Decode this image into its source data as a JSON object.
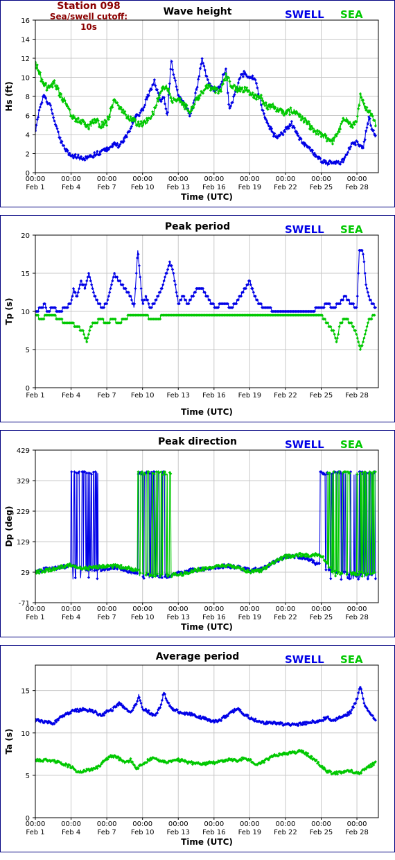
{
  "header": {
    "station": "Station 098",
    "cutoff": "Sea/swell cutoff: 10s"
  },
  "legend": {
    "swell": "SWELL",
    "sea": "SEA"
  },
  "colors": {
    "swell": "#0000e6",
    "sea": "#00c800",
    "station": "#8b0000",
    "border": "#000080"
  },
  "chart_data": [
    {
      "type": "line",
      "title": "Wave height",
      "xlabel": "Time (UTC)",
      "ylabel": "Hs (ft)",
      "ylim": [
        0,
        16
      ],
      "yticks": [
        0,
        2,
        4,
        6,
        8,
        10,
        12,
        14,
        16
      ],
      "xlim": [
        0,
        28.8
      ],
      "xticks": [
        0,
        3,
        6,
        9,
        12,
        15,
        18,
        21,
        24,
        27
      ],
      "xtick_top": "00:00",
      "xtick_labels": [
        "Feb 1",
        "Feb 4",
        "Feb 7",
        "Feb 10",
        "Feb 13",
        "Feb 16",
        "Feb 19",
        "Feb 22",
        "Feb 25",
        "Feb 28"
      ],
      "show_time_row": true,
      "grid": true,
      "series": [
        {
          "name": "SWELL",
          "color": "#0000e6",
          "noise": 0.25,
          "x": [
            0,
            0.3,
            0.7,
            1.2,
            1.6,
            2.0,
            2.5,
            3.0,
            4.0,
            5.0,
            6.0,
            6.6,
            7.0,
            7.6,
            8.0,
            8.4,
            9.0,
            9.6,
            10.0,
            10.5,
            10.8,
            11.1,
            11.4,
            12.0,
            12.6,
            13.0,
            13.3,
            13.6,
            14.0,
            14.5,
            15.0,
            15.5,
            16.0,
            16.3,
            16.8,
            17.2,
            17.6,
            18.0,
            18.4,
            18.8,
            19.2,
            19.6,
            20.0,
            20.5,
            21.0,
            21.5,
            22.0,
            22.5,
            23.0,
            23.5,
            24.0,
            24.5,
            25.0,
            25.5,
            26.0,
            26.5,
            27.0,
            27.5,
            28.0,
            28.3,
            28.6
          ],
          "y": [
            4.2,
            6.5,
            8.0,
            7.2,
            5.5,
            3.8,
            2.5,
            1.8,
            1.5,
            1.9,
            2.5,
            3.0,
            2.8,
            3.8,
            4.5,
            5.8,
            6.5,
            8.5,
            9.5,
            7.5,
            8.0,
            6.0,
            11.8,
            8.0,
            7.2,
            5.8,
            7.5,
            9.0,
            12.0,
            9.5,
            8.5,
            9.0,
            11.0,
            6.5,
            8.5,
            10.0,
            10.5,
            9.8,
            10.0,
            8.0,
            6.0,
            5.0,
            4.0,
            3.8,
            4.5,
            5.2,
            4.0,
            3.0,
            2.5,
            1.8,
            1.2,
            1.0,
            1.1,
            1.0,
            1.5,
            3.0,
            3.2,
            2.5,
            5.8,
            4.5,
            3.6
          ]
        },
        {
          "name": "SEA",
          "color": "#00c800",
          "noise": 0.35,
          "x": [
            0,
            0.3,
            0.7,
            1.2,
            1.6,
            2.0,
            2.5,
            3.0,
            4.0,
            4.5,
            5.0,
            5.5,
            6.0,
            6.6,
            7.0,
            7.5,
            8.0,
            8.5,
            9.0,
            9.5,
            10.0,
            10.5,
            11.0,
            11.5,
            12.0,
            12.5,
            13.0,
            13.5,
            14.0,
            14.5,
            15.0,
            15.5,
            16.0,
            16.5,
            17.0,
            17.5,
            18.0,
            18.5,
            19.0,
            19.5,
            20.0,
            20.5,
            21.0,
            21.5,
            22.0,
            22.5,
            23.0,
            23.5,
            24.0,
            24.5,
            25.0,
            25.5,
            26.0,
            26.5,
            27.0,
            27.3,
            27.6,
            28.0,
            28.3,
            28.6
          ],
          "y": [
            11.5,
            10.5,
            9.2,
            8.8,
            9.5,
            8.3,
            7.5,
            6.0,
            5.2,
            4.8,
            5.5,
            5.0,
            5.3,
            7.5,
            7.0,
            6.2,
            5.6,
            5.2,
            5.0,
            5.6,
            6.5,
            8.5,
            9.2,
            7.5,
            7.8,
            7.0,
            6.5,
            7.5,
            8.5,
            9.0,
            8.7,
            8.5,
            10.2,
            9.0,
            8.8,
            8.8,
            8.5,
            8.0,
            7.8,
            6.8,
            7.0,
            6.5,
            6.2,
            6.5,
            6.3,
            5.5,
            5.0,
            4.2,
            4.0,
            3.6,
            3.3,
            4.5,
            5.8,
            5.0,
            5.2,
            8.5,
            7.0,
            6.5,
            6.0,
            5.0
          ]
        }
      ]
    },
    {
      "type": "line",
      "title": "Peak period",
      "xlabel": "Time (UTC)",
      "ylabel": "Tp (s)",
      "ylim": [
        0,
        20
      ],
      "yticks": [
        0,
        5,
        10,
        15,
        20
      ],
      "xlim": [
        0,
        28.8
      ],
      "xticks": [
        0,
        3,
        6,
        9,
        12,
        15,
        18,
        21,
        24,
        27
      ],
      "xtick_labels": [
        "Feb 1",
        "Feb 4",
        "Feb 7",
        "Feb 10",
        "Feb 13",
        "Feb 16",
        "Feb 19",
        "Feb 22",
        "Feb 25",
        "Feb 28"
      ],
      "show_time_row": false,
      "grid": true,
      "series": [
        {
          "name": "SWELL",
          "color": "#0000e6",
          "noise": 0.0,
          "spiky": true,
          "x": [
            0,
            0.5,
            0.8,
            1.0,
            1.5,
            2.0,
            2.5,
            3.0,
            3.2,
            3.5,
            3.8,
            4.2,
            4.5,
            5.0,
            5.3,
            5.6,
            6.0,
            6.3,
            6.6,
            7.0,
            7.5,
            8.0,
            8.3,
            8.6,
            9.0,
            9.3,
            9.6,
            10.0,
            10.3,
            10.6,
            11.0,
            11.3,
            11.6,
            12.0,
            12.4,
            12.8,
            13.2,
            13.6,
            14.0,
            14.4,
            14.8,
            15.2,
            15.6,
            16.0,
            16.4,
            16.8,
            17.2,
            17.6,
            18.0,
            18.4,
            18.8,
            19.2,
            19.6,
            20.0,
            21.0,
            22.0,
            23.0,
            24.0,
            24.5,
            25.0,
            25.5,
            26.0,
            26.5,
            27.0,
            27.2,
            27.5,
            27.8,
            28.0,
            28.3,
            28.6
          ],
          "y": [
            10,
            10.5,
            11,
            10,
            10.5,
            10,
            10.5,
            11,
            13,
            12,
            14,
            13,
            15,
            12,
            11,
            10.5,
            11,
            13,
            15,
            14,
            13,
            12,
            10.5,
            18,
            11,
            12,
            10.5,
            11,
            12,
            13,
            15,
            16.5,
            15,
            11,
            12,
            11,
            12,
            13,
            13,
            12,
            11,
            10.5,
            11,
            11,
            10.5,
            11,
            12,
            13,
            14,
            12,
            11,
            10.5,
            10.5,
            10,
            10,
            10,
            10,
            10.5,
            11,
            10.5,
            11,
            12,
            11,
            10.5,
            18,
            18,
            13,
            12,
            11,
            10.5
          ]
        },
        {
          "name": "SEA",
          "color": "#00c800",
          "noise": 0.0,
          "spiky": true,
          "x": [
            0,
            0.5,
            1.0,
            1.5,
            2.0,
            2.5,
            3.0,
            3.5,
            4.0,
            4.3,
            4.6,
            5.0,
            5.5,
            6.0,
            6.5,
            7.0,
            7.5,
            8.0,
            9.0,
            10.0,
            11.0,
            12.0,
            13.0,
            14.0,
            15.0,
            16.0,
            17.0,
            18.0,
            19.0,
            20.0,
            21.0,
            22.0,
            23.0,
            23.5,
            24.0,
            24.5,
            25.0,
            25.3,
            25.6,
            26.0,
            26.5,
            27.0,
            27.3,
            27.6,
            28.0,
            28.5
          ],
          "y": [
            9.5,
            9,
            9.5,
            9.5,
            9,
            8.5,
            8.5,
            8,
            7.5,
            6,
            8,
            8.5,
            9,
            8.5,
            9,
            8.5,
            9,
            9.5,
            9.5,
            9,
            9.5,
            9.5,
            9.5,
            9.5,
            9.5,
            9.5,
            9.5,
            9.5,
            9.5,
            9.5,
            9.5,
            9.5,
            9.5,
            9.5,
            9.5,
            8.5,
            7.5,
            6,
            8.5,
            9,
            8.5,
            7,
            5,
            6.5,
            9,
            9.5
          ]
        }
      ]
    },
    {
      "type": "line",
      "title": "Peak direction",
      "xlabel": "Time (UTC)",
      "ylabel": "Dp (deg)",
      "ylim": [
        -71,
        429
      ],
      "yticks": [
        -71,
        29,
        129,
        229,
        329,
        429
      ],
      "xlim": [
        0,
        28.8
      ],
      "xticks": [
        0,
        3,
        6,
        9,
        12,
        15,
        18,
        21,
        24,
        27
      ],
      "xtick_top": "00:00",
      "xtick_labels": [
        "Feb 1",
        "Feb 4",
        "Feb 7",
        "Feb 10",
        "Feb 13",
        "Feb 16",
        "Feb 19",
        "Feb 22",
        "Feb 25",
        "Feb 28"
      ],
      "show_time_row": true,
      "grid": true,
      "series": [
        {
          "name": "SWELL",
          "color": "#0000e6",
          "noise": 6,
          "flip_zones": [
            [
              3.0,
              5.3
            ],
            [
              8.5,
              11.5
            ],
            [
              23.9,
              28.6
            ]
          ],
          "flip_high": 358,
          "flip_low": 5,
          "x": [
            0,
            1,
            2,
            3,
            4,
            5,
            6,
            7,
            8,
            9,
            10,
            11,
            12,
            13,
            14,
            15,
            16,
            17,
            18,
            19,
            20,
            21,
            22,
            23,
            24,
            25,
            26,
            27,
            28,
            28.6
          ],
          "y": [
            29,
            40,
            45,
            50,
            40,
            35,
            40,
            45,
            30,
            20,
            18,
            15,
            25,
            35,
            40,
            42,
            50,
            45,
            35,
            40,
            60,
            80,
            82,
            70,
            50,
            30,
            25,
            20,
            20,
            20
          ]
        },
        {
          "name": "SEA",
          "color": "#00c800",
          "noise": 6,
          "flip_zones": [
            [
              8.5,
              11.5
            ],
            [
              24.5,
              28.6
            ]
          ],
          "flip_high": 358,
          "flip_low": 15,
          "x": [
            0,
            1,
            2,
            3,
            4,
            5,
            6,
            7,
            8,
            9,
            10,
            11,
            12,
            13,
            14,
            15,
            16,
            17,
            18,
            19,
            20,
            21,
            22,
            23,
            24,
            25,
            26,
            27,
            28,
            28.6
          ],
          "y": [
            29,
            35,
            45,
            52,
            40,
            45,
            50,
            48,
            40,
            30,
            20,
            20,
            20,
            30,
            40,
            45,
            50,
            45,
            30,
            35,
            60,
            80,
            85,
            85,
            85,
            30,
            25,
            25,
            25,
            25
          ]
        }
      ]
    },
    {
      "type": "line",
      "title": "Average period",
      "xlabel": "Time (UTC)",
      "ylabel": "Ta (s)",
      "ylim": [
        0,
        18
      ],
      "yticks": [
        0,
        5,
        10,
        15
      ],
      "xlim": [
        0,
        28.8
      ],
      "xticks": [
        0,
        3,
        6,
        9,
        12,
        15,
        18,
        21,
        24,
        27
      ],
      "xtick_top": "00:00",
      "xtick_labels": [
        "Feb 1",
        "Feb 4",
        "Feb 7",
        "Feb 10",
        "Feb 13",
        "Feb 16",
        "Feb 19",
        "Feb 22",
        "Feb 25",
        "Feb 28"
      ],
      "show_time_row": true,
      "grid": true,
      "series": [
        {
          "name": "SWELL",
          "color": "#0000e6",
          "noise": 0.18,
          "x": [
            0,
            1,
            1.5,
            2,
            3,
            4,
            5,
            5.5,
            6,
            6.5,
            7,
            7.5,
            8,
            8.5,
            8.7,
            9,
            9.5,
            10,
            10.5,
            10.8,
            11,
            11.5,
            12,
            13,
            14,
            15,
            15.5,
            16,
            16.5,
            17,
            17.5,
            18,
            18.5,
            19,
            20,
            21,
            22,
            23,
            24,
            24.5,
            25,
            26,
            26.5,
            27,
            27.3,
            27.6,
            28,
            28.6
          ],
          "y": [
            11.5,
            11.3,
            11.0,
            11.8,
            12.5,
            12.8,
            12.5,
            12.0,
            12.5,
            12.8,
            13.5,
            13.0,
            12.5,
            13.5,
            14.5,
            12.8,
            12.5,
            12.0,
            13.0,
            14.8,
            14.0,
            12.8,
            12.5,
            12.2,
            11.8,
            11.3,
            11.5,
            12.0,
            12.5,
            12.8,
            12.2,
            11.8,
            11.5,
            11.2,
            11.2,
            11.0,
            11.0,
            11.2,
            11.5,
            11.8,
            11.5,
            12.0,
            12.5,
            14.0,
            15.5,
            13.5,
            12.5,
            11.5
          ]
        },
        {
          "name": "SEA",
          "color": "#00c800",
          "noise": 0.18,
          "x": [
            0,
            1,
            2,
            3,
            3.5,
            4,
            5,
            5.5,
            6,
            6.5,
            7,
            7.5,
            8,
            8.5,
            9,
            9.5,
            10,
            11,
            12,
            13,
            14,
            15,
            16,
            17,
            17.5,
            18,
            18.5,
            19,
            20,
            20.5,
            21,
            22,
            22.5,
            23,
            23.5,
            24,
            24.5,
            25,
            26,
            26.5,
            27,
            27.5,
            28,
            28.6
          ],
          "y": [
            6.8,
            6.8,
            6.5,
            6.0,
            5.5,
            5.5,
            5.8,
            6.3,
            7.0,
            7.3,
            7.0,
            6.5,
            6.8,
            5.8,
            6.3,
            6.8,
            7.0,
            6.5,
            6.8,
            6.5,
            6.3,
            6.5,
            6.8,
            6.8,
            7.0,
            6.8,
            6.3,
            6.5,
            7.3,
            7.5,
            7.5,
            7.8,
            7.8,
            7.3,
            6.8,
            6.0,
            5.5,
            5.2,
            5.5,
            5.5,
            5.2,
            5.5,
            6.0,
            6.5
          ]
        }
      ]
    }
  ]
}
